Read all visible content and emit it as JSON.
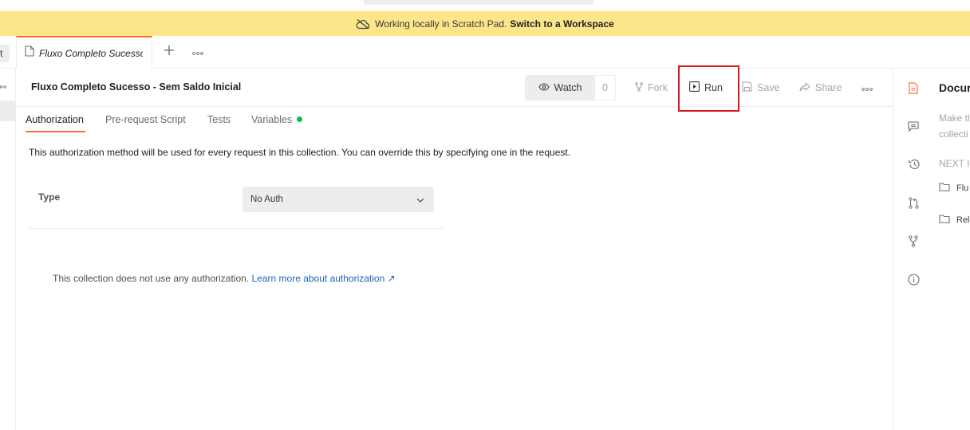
{
  "banner": {
    "text": "Working locally in Scratch Pad.",
    "link": "Switch to a Workspace"
  },
  "left_stub": {
    "label": "t"
  },
  "tabs": [
    {
      "label": "Fluxo Completo Sucesso"
    }
  ],
  "header": {
    "title": "Fluxo Completo Sucesso - Sem Saldo Inicial",
    "watch_label": "Watch",
    "watch_count": "0",
    "fork_label": "Fork",
    "run_label": "Run",
    "save_label": "Save",
    "share_label": "Share"
  },
  "subtabs": {
    "authorization": "Authorization",
    "pre_request": "Pre-request Script",
    "tests": "Tests",
    "variables": "Variables"
  },
  "auth": {
    "description": "This authorization method will be used for every request in this collection. You can override this by specifying one in the request.",
    "type_label": "Type",
    "type_value": "No Auth",
    "no_auth_text": "This collection does not use any authorization.",
    "learn_more": "Learn more about authorization ↗"
  },
  "right_panel": {
    "title": "Docur",
    "desc_line1": "Make tl",
    "desc_line2": "collecti",
    "next_label": "NEXT II",
    "items": [
      "Flu",
      "Rel"
    ]
  },
  "colors": {
    "banner": "#fde58a",
    "accent": "#ff6c37",
    "highlight": "#d9181e",
    "link": "#1d63b8",
    "variables_dot": "#0cbb52"
  }
}
